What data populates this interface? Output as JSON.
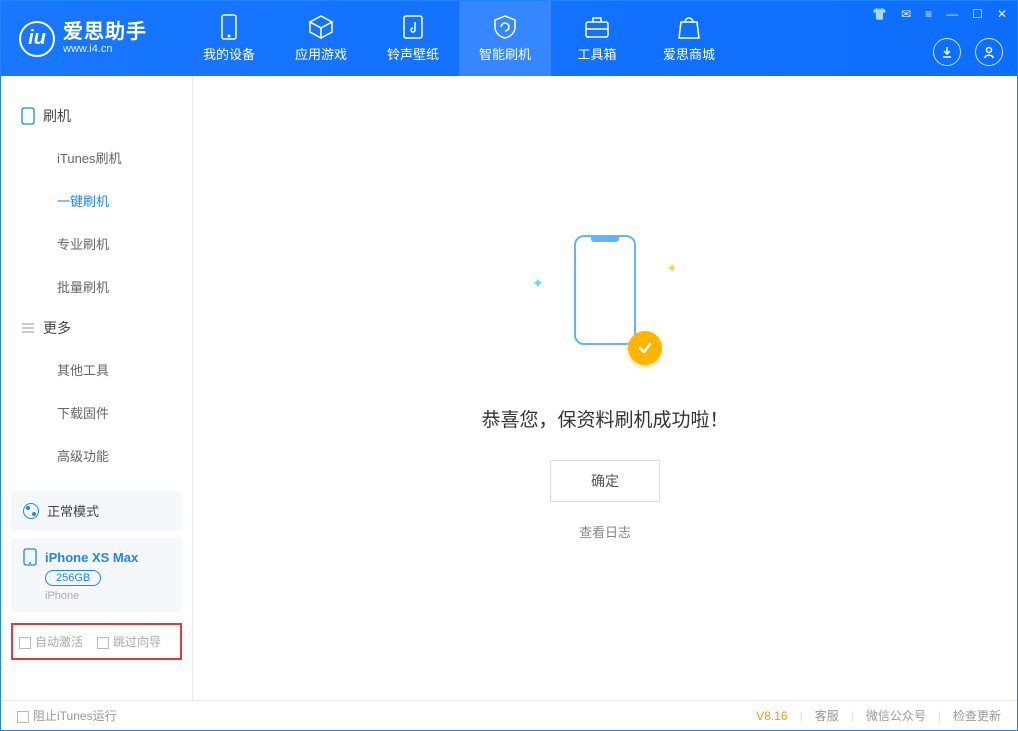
{
  "brand": {
    "title": "爱思助手",
    "subtitle": "www.i4.cn"
  },
  "tabs": {
    "device": "我的设备",
    "apps": "应用游戏",
    "ringtones": "铃声壁纸",
    "flash": "智能刷机",
    "toolbox": "工具箱",
    "store": "爱思商城"
  },
  "sidebar": {
    "group_flash": "刷机",
    "items": {
      "itunes": "iTunes刷机",
      "oneclick": "一键刷机",
      "pro": "专业刷机",
      "batch": "批量刷机"
    },
    "group_more": "更多",
    "more": {
      "other": "其他工具",
      "firmware": "下载固件",
      "advanced": "高级功能"
    }
  },
  "mode": {
    "label": "正常模式"
  },
  "device": {
    "name": "iPhone XS Max",
    "storage": "256GB",
    "type": "iPhone"
  },
  "checkboxes": {
    "auto_activate": "自动激活",
    "skip_guide": "跳过向导"
  },
  "main": {
    "success": "恭喜您，保资料刷机成功啦！",
    "ok": "确定",
    "view_log": "查看日志"
  },
  "footer": {
    "block_itunes": "阻止iTunes运行",
    "version": "V8.16",
    "support": "客服",
    "wechat": "微信公众号",
    "update": "检查更新"
  }
}
